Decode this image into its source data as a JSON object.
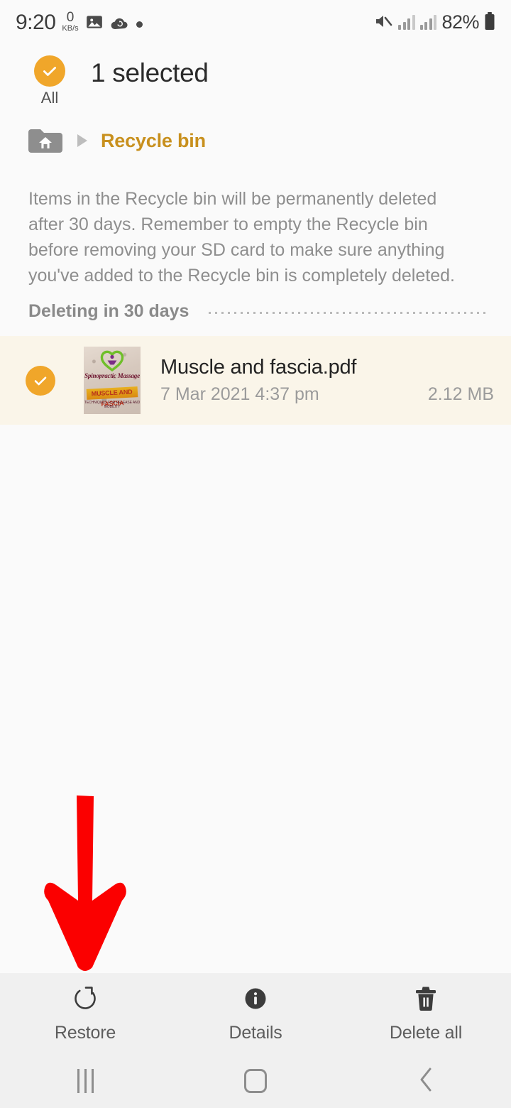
{
  "status_bar": {
    "time": "9:20",
    "network_speed_value": "0",
    "network_speed_unit": "KB/s",
    "icons": [
      "image-icon",
      "cloud-sync-icon",
      "dot-icon",
      "mute-icon",
      "signal-bars-icon",
      "signal-bars-icon"
    ],
    "battery_percent": "82%"
  },
  "selection_header": {
    "select_all_label": "All",
    "title": "1 selected",
    "select_all_checked": true
  },
  "breadcrumb": {
    "home_icon": "home-folder-icon",
    "separator_icon": "triangle-right-icon",
    "current": "Recycle bin"
  },
  "info": {
    "text": "Items in the Recycle bin will be permanently deleted after 30 days. Remember to empty the Recycle bin before removing your SD card to make sure anything you've added to the Recycle bin is completely deleted."
  },
  "group": {
    "title": "Deleting in 30 days"
  },
  "file": {
    "selected": true,
    "name": "Muscle and fascia.pdf",
    "date": "7 Mar 2021 4:37 pm",
    "size": "2.12 MB",
    "thumbnail": {
      "cursive_text": "Spinopractic Massage",
      "band_text": "MUSCLE AND FASCIA",
      "sub_text": "TECHNIQUES FOR RELEASE AND MOBILITY"
    }
  },
  "annotation": {
    "arrow": "red-down-arrow",
    "color": "#fb0000",
    "points_to": "restore-button"
  },
  "toolbar": {
    "items": [
      {
        "label": "Restore",
        "icon": "restore-icon"
      },
      {
        "label": "Details",
        "icon": "info-icon"
      },
      {
        "label": "Delete all",
        "icon": "trash-icon"
      }
    ]
  },
  "navbar": {
    "items": [
      {
        "name": "recents",
        "icon": "recents-icon"
      },
      {
        "name": "home",
        "icon": "home-icon"
      },
      {
        "name": "back",
        "icon": "back-chevron-icon"
      }
    ]
  },
  "colors": {
    "accent": "#f0a62a",
    "breadcrumb_text": "#c8901e",
    "selected_row_bg": "#faf5e9",
    "page_bg": "#fafafa",
    "toolbar_bg": "#f0f0f0",
    "annotation_red": "#fb0000"
  }
}
